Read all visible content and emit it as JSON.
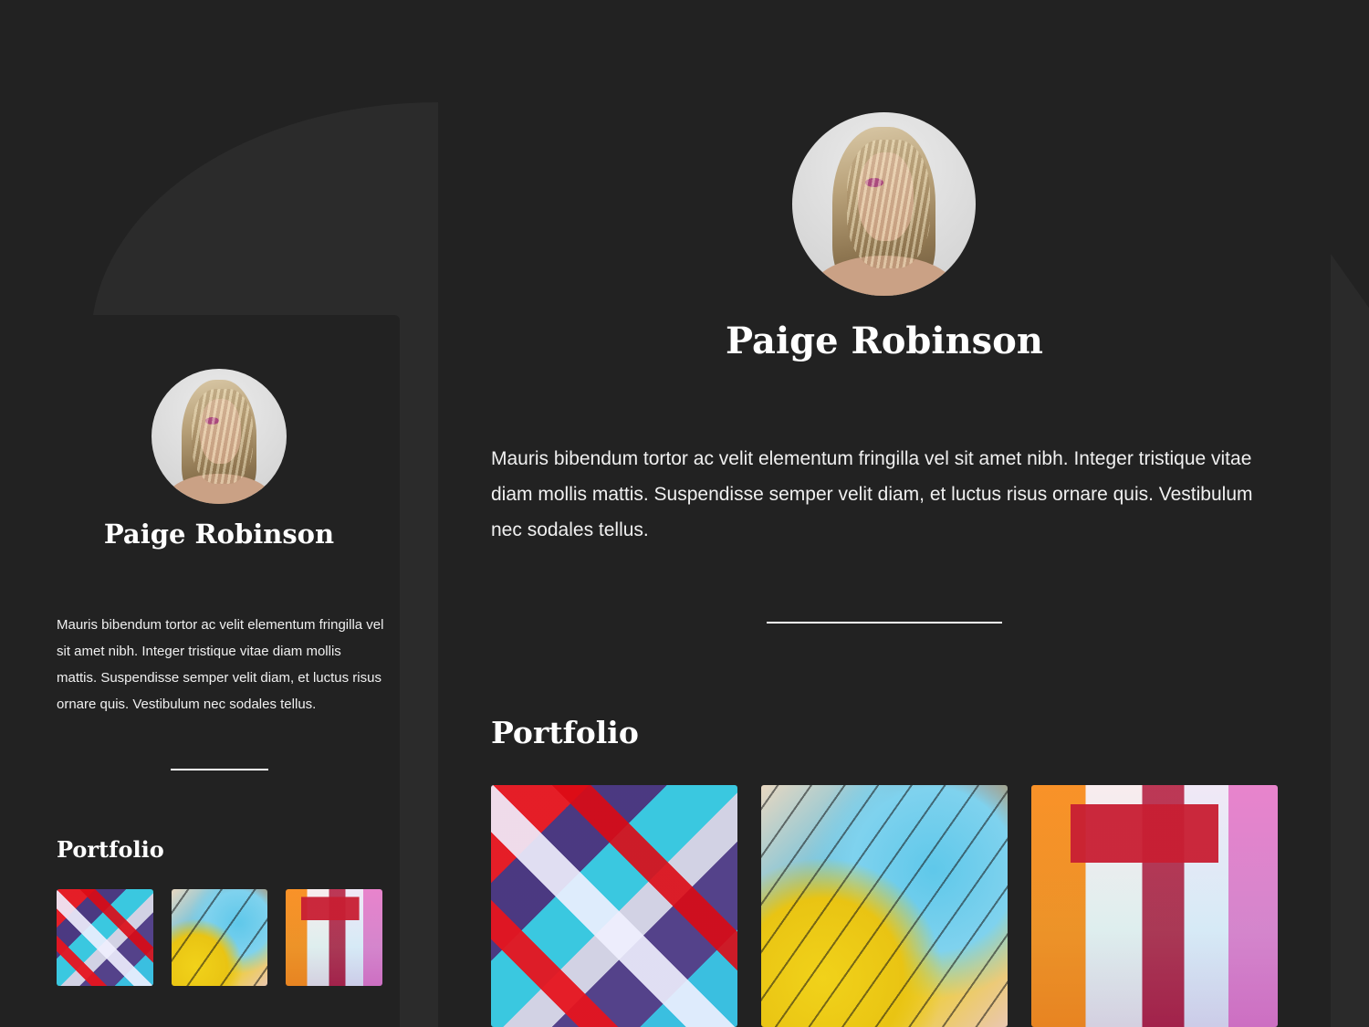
{
  "profile": {
    "name": "Paige Robinson",
    "bio": "Mauris bibendum tortor ac velit elementum fringilla vel sit amet nibh. Integer tristique vitae diam mollis mattis. Suspendisse semper velit diam, et luctus risus ornare quis. Vestibulum nec sodales tellus."
  },
  "portfolio": {
    "title": "Portfolio",
    "items": [
      {
        "alt": "abstract painting red blue"
      },
      {
        "alt": "abstract painting yellow splatter"
      },
      {
        "alt": "abstract painting pink orange"
      }
    ]
  },
  "colors": {
    "background": "#222222",
    "panel": "#2b2b2b",
    "text": "#ffffff"
  }
}
